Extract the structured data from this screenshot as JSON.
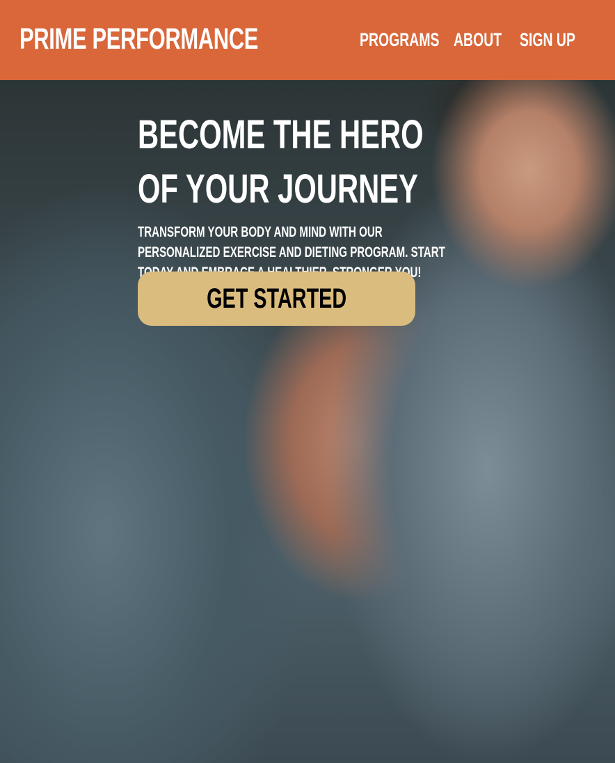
{
  "header": {
    "logo": "PRIME PERFORMANCE",
    "nav": [
      "PROGRAMS",
      "ABOUT",
      "SIGN UP"
    ]
  },
  "hero": {
    "title_lines": [
      "BECOME THE HERO",
      "OF YOUR JOURNEY"
    ],
    "subtitle_lines": [
      "TRANSFORM YOUR BODY AND MIND WITH OUR",
      "PERSONALIZED EXERCISE AND DIETING PROGRAM. START",
      "TODAY AND EMBRACE A HEALTHIER, STRONGER YOU!"
    ],
    "cta": "GET STARTED"
  },
  "colors": {
    "header": "#d9673a",
    "cta": "#dbbc7f"
  }
}
